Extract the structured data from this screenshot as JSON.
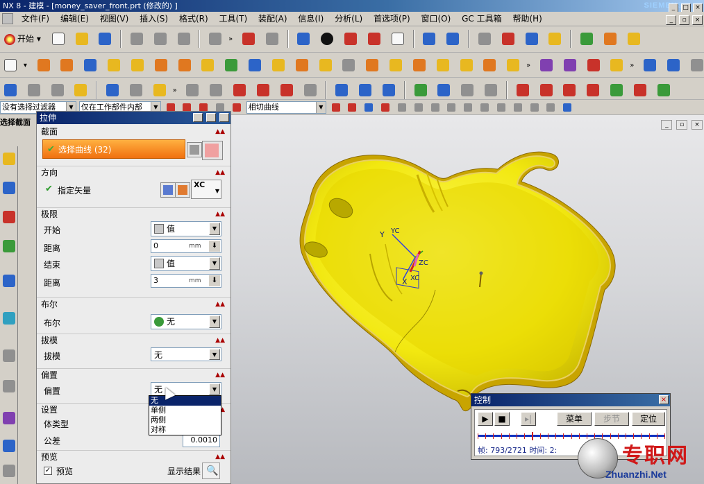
{
  "window": {
    "title": "NX 8 - 建模 - [money_saver_front.prt (修改的) ]",
    "brand": "SIEMENS"
  },
  "menu": [
    "文件(F)",
    "编辑(E)",
    "视图(V)",
    "插入(S)",
    "格式(R)",
    "工具(T)",
    "装配(A)",
    "信息(I)",
    "分析(L)",
    "首选项(P)",
    "窗口(O)",
    "GC 工具箱",
    "帮助(H)"
  ],
  "toolbar": {
    "start_label": "开始",
    "filter_combo": "没有选择过滤器",
    "scope_combo": "仅在工作部件内部",
    "curve_rule_combo": "相切曲线"
  },
  "resource_bar": {
    "tab_label": "选择截面"
  },
  "dialog": {
    "title": "拉伸",
    "section": {
      "header": "截面",
      "select_curve": "选择曲线 (32)"
    },
    "direction": {
      "header": "方向",
      "vector_label": "指定矢量",
      "vector_value": "XC"
    },
    "limits": {
      "header": "极限",
      "start_label": "开始",
      "start_value": "值",
      "start_distance_label": "距离",
      "start_distance": "0",
      "end_label": "结束",
      "end_value": "值",
      "end_distance_label": "距离",
      "end_distance": "3",
      "unit": "mm"
    },
    "boolean": {
      "header": "布尔",
      "label": "布尔",
      "value": "无"
    },
    "draft": {
      "header": "拔模",
      "label": "拔模",
      "value": "无"
    },
    "offset": {
      "header": "偏置",
      "label": "偏置",
      "value": "无",
      "options": [
        "无",
        "单侧",
        "两侧",
        "对称"
      ]
    },
    "settings": {
      "header": "设置",
      "body_type_label": "体类型",
      "tolerance_label": "公差",
      "tolerance_value": "0.0010"
    },
    "preview": {
      "header": "预览",
      "checkbox_label": "预览",
      "show_result_label": "显示结果"
    }
  },
  "viewport": {
    "axis_labels": {
      "y": "Y",
      "yc": "YC",
      "zc": "ZC",
      "x": "X",
      "xc": "XC"
    },
    "model_color": "#f4ec10"
  },
  "control_panel": {
    "title": "控制",
    "menu_button": "菜单",
    "step_button": "步节",
    "position_button": "定位",
    "status": "帧: 793/2721 时间: 2:",
    "progress": 0.29
  },
  "watermark": {
    "text": "专职网",
    "url": "Zhuanzhi.Net"
  },
  "colors": {
    "title_bar": "#0a246a",
    "accent_orange": "#f07010",
    "check_green": "#2a9a2a"
  }
}
